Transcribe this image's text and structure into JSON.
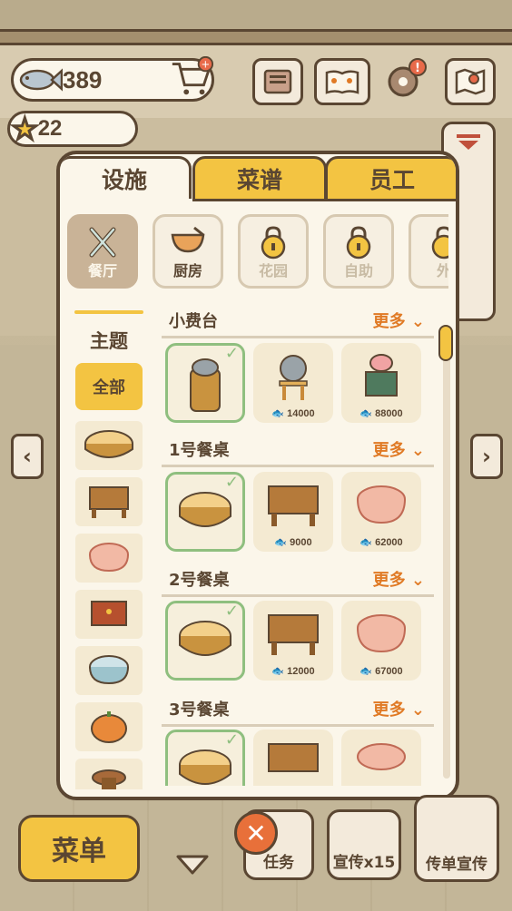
{
  "header": {
    "fish_count": "389",
    "star_count": "22"
  },
  "tabs": [
    {
      "label": "设施"
    },
    {
      "label": "菜谱"
    },
    {
      "label": "员工"
    }
  ],
  "categories": [
    {
      "label": "餐厅"
    },
    {
      "label": "厨房"
    },
    {
      "label": "花园"
    },
    {
      "label": "自助"
    },
    {
      "label": "外"
    }
  ],
  "sidebar": {
    "title": "主题",
    "all_label": "全部"
  },
  "sections": [
    {
      "title": "小费台",
      "more": "更多",
      "items": [
        {
          "price": ""
        },
        {
          "price": "14000"
        },
        {
          "price": "88000"
        }
      ]
    },
    {
      "title": "1号餐桌",
      "more": "更多",
      "items": [
        {
          "price": ""
        },
        {
          "price": "9000"
        },
        {
          "price": "62000"
        }
      ]
    },
    {
      "title": "2号餐桌",
      "more": "更多",
      "items": [
        {
          "price": ""
        },
        {
          "price": "12000"
        },
        {
          "price": "67000"
        }
      ]
    },
    {
      "title": "3号餐桌",
      "more": "更多",
      "items": [
        {
          "price": ""
        },
        {
          "price": ""
        },
        {
          "price": ""
        }
      ]
    }
  ],
  "bottom": {
    "menu_label": "菜单",
    "task_label": "任务",
    "promo_label": "宣传x15",
    "flyer_label": "传单宣传"
  },
  "colors": {
    "accent_yellow": "#f3c442",
    "outline": "#5a4632",
    "panel": "#fbf6ea",
    "more_orange": "#e07a25",
    "owned_green": "#8fbf7f"
  }
}
